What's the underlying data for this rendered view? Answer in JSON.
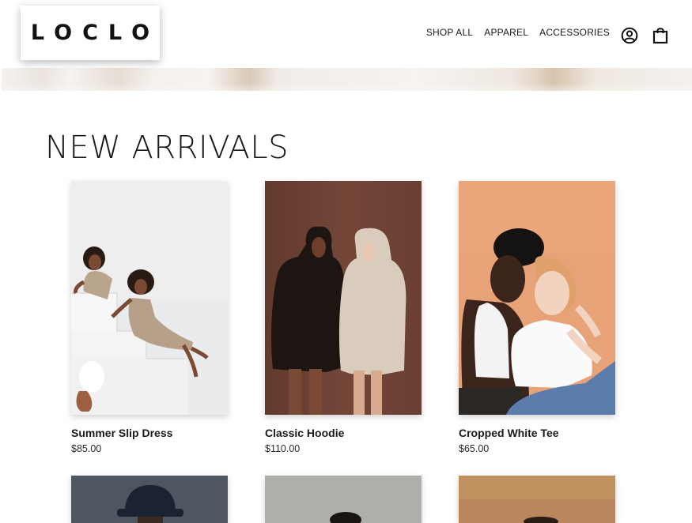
{
  "header": {
    "logo": "LOCLO",
    "nav": [
      "SHOP ALL",
      "APPAREL",
      "ACCESSORIES"
    ],
    "icons": {
      "account": "user-circle-icon",
      "cart": "shopping-bag-icon"
    }
  },
  "main": {
    "section_title": "NEW ARRIVALS",
    "products": [
      {
        "name": "Summer Slip Dress",
        "price": "$85.00",
        "image": "summer-slip-dress-photo"
      },
      {
        "name": "Classic Hoodie",
        "price": "$110.00",
        "image": "classic-hoodie-photo"
      },
      {
        "name": "Cropped White Tee",
        "price": "$65.00",
        "image": "cropped-white-tee-photo"
      }
    ],
    "next_row_images": [
      "bucket-hat-photo",
      "grey-backdrop-photo",
      "tan-backdrop-photo"
    ]
  },
  "colors": {
    "text": "#1a1a1a",
    "photo_bg_1": "#e9eaeb",
    "photo_bg_2": "#6e4335",
    "photo_bg_3": "#e9a074"
  }
}
